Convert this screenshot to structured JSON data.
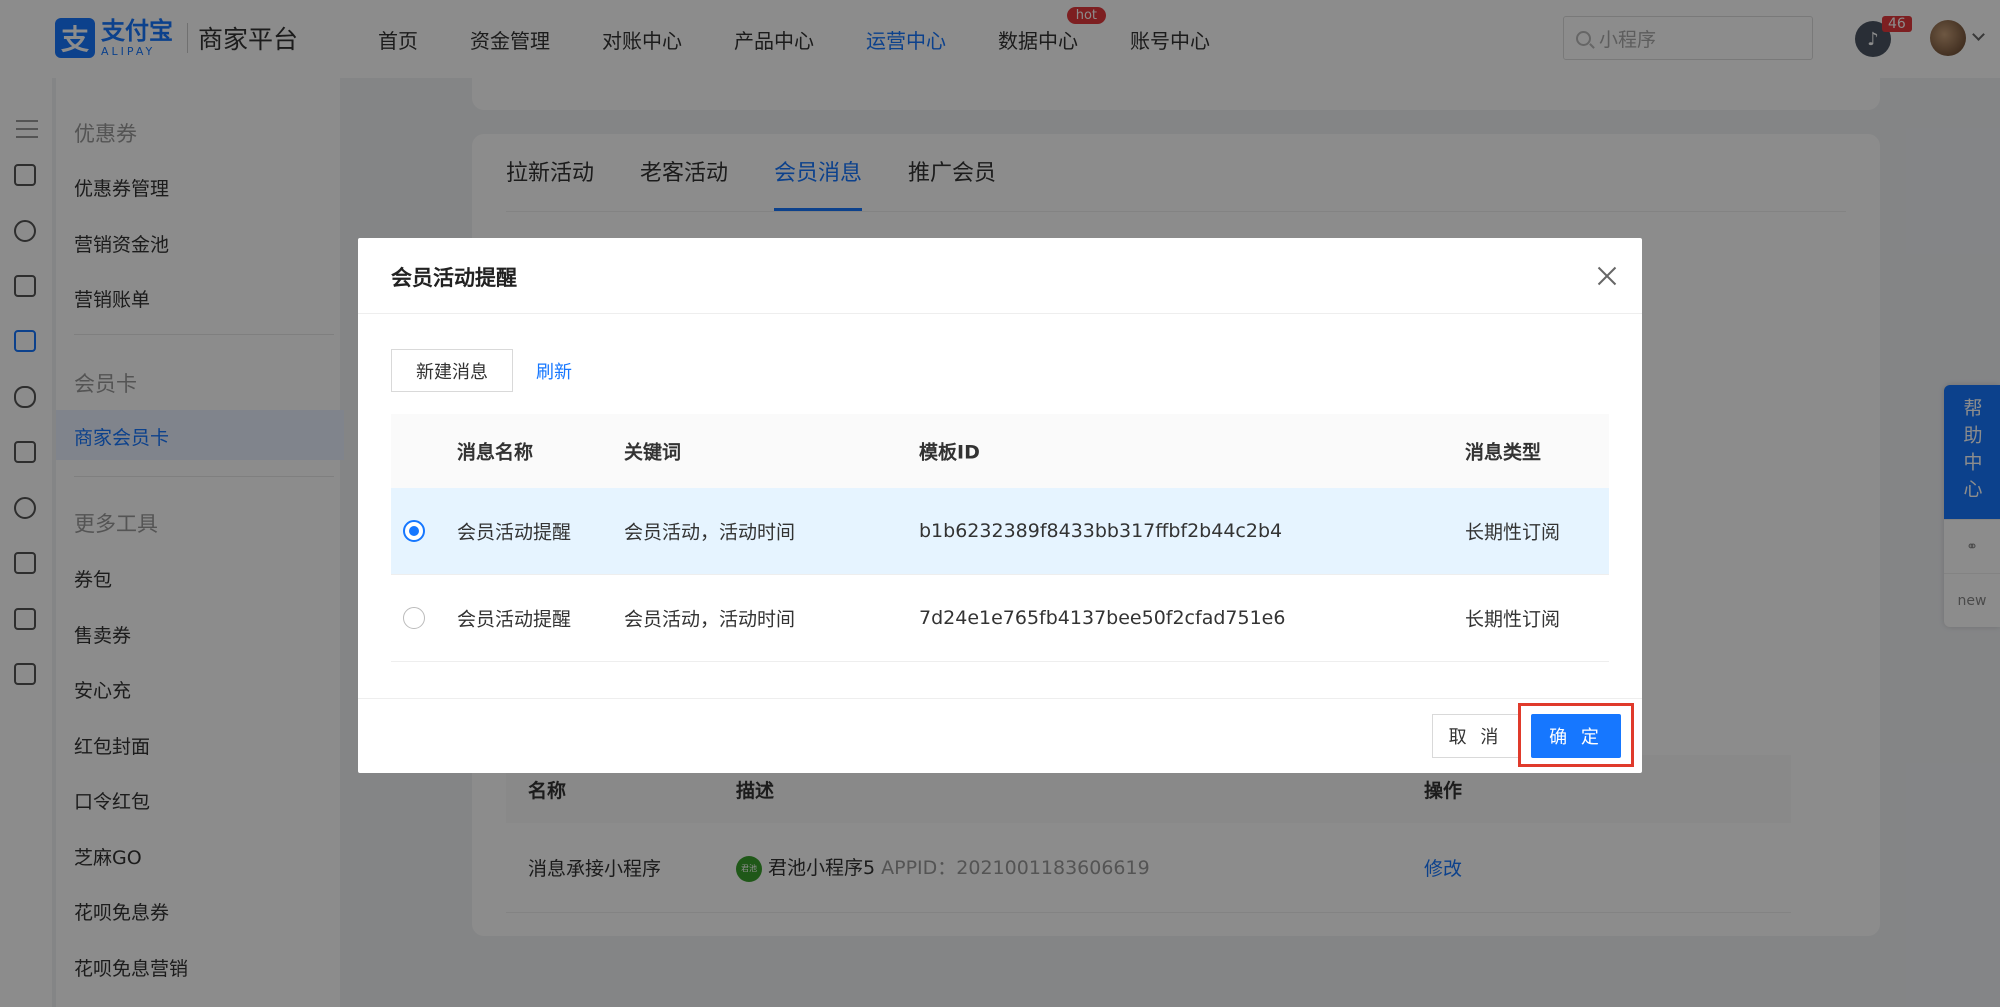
{
  "header": {
    "logo_cn": "支付宝",
    "logo_en": "ALIPAY",
    "platform": "商家平台",
    "nav": [
      "首页",
      "资金管理",
      "对账中心",
      "产品中心",
      "运营中心",
      "数据中心",
      "账号中心"
    ],
    "hot_label": "hot",
    "search_placeholder": "小程序",
    "notification_count": "46"
  },
  "sidebar": {
    "group_coupon": "优惠券",
    "coupon_items": [
      "优惠券管理",
      "营销资金池",
      "营销账单"
    ],
    "group_member": "会员卡",
    "member_items": [
      "商家会员卡"
    ],
    "group_tools": "更多工具",
    "tool_items": [
      "券包",
      "售卖券",
      "安心充",
      "红包封面",
      "口令红包",
      "芝麻GO",
      "花呗免息券",
      "花呗免息营销"
    ]
  },
  "main": {
    "tabs": [
      "拉新活动",
      "老客活动",
      "会员消息",
      "推广会员"
    ],
    "bg_table": {
      "headers": [
        "名称",
        "描述",
        "操作"
      ],
      "row_name": "消息承接小程序",
      "row_app": "君池小程序5",
      "row_appid": "APPID：2021001183606619",
      "row_action": "修改"
    }
  },
  "help": {
    "label": "帮助中心",
    "new_label": "new"
  },
  "modal": {
    "title": "会员活动提醒",
    "new_button": "新建消息",
    "refresh": "刷新",
    "columns": [
      "消息名称",
      "关键词",
      "模板ID",
      "消息类型"
    ],
    "rows": [
      {
        "name": "会员活动提醒",
        "keywords": "会员活动，活动时间",
        "template_id": "b1b6232389f8433bb317ffbf2b44c2b4",
        "type": "长期性订阅",
        "selected": true
      },
      {
        "name": "会员活动提醒",
        "keywords": "会员活动，活动时间",
        "template_id": "7d24e1e765fb4137bee50f2cfad751e6",
        "type": "长期性订阅",
        "selected": false
      }
    ],
    "cancel": "取 消",
    "ok": "确 定"
  }
}
